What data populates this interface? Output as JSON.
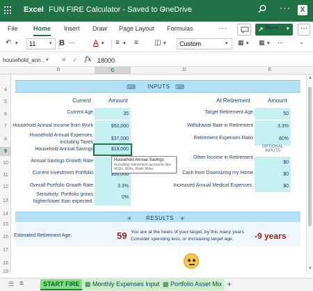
{
  "titlebar": {
    "app_name": "Excel",
    "doc_title": "FUN FIRE Calculator - Saved to OneDrive",
    "app_icon_letter": "X"
  },
  "ribbon": {
    "tabs": [
      "File",
      "Home",
      "Insert",
      "Draw",
      "Page Layout",
      "Formulas"
    ],
    "active_tab": "Home",
    "share_label": "Share",
    "more_label": "···"
  },
  "toolbar": {
    "font_size": "11",
    "bold_label": "B",
    "font_color_label": "A",
    "number_format": "Custom"
  },
  "formula_bar": {
    "name_box": "household_ann...",
    "fx_label": "fx",
    "value": "18000"
  },
  "columns": [
    "B",
    "C",
    "D",
    "E"
  ],
  "selected_column": "C",
  "rows": [
    "4",
    "5",
    "6",
    "7",
    "8",
    "9",
    "10",
    "11",
    "12",
    "13",
    "14",
    "15",
    "16",
    "17",
    "18",
    "19"
  ],
  "selected_row": "9",
  "inputs": {
    "banner": "INPUTS",
    "current_header": "Current",
    "amount_header": "Amount",
    "at_retirement_header": "At Retirement",
    "amount_header_right": "Amount",
    "left_rows": [
      {
        "label": "Current Age",
        "value": "35"
      },
      {
        "label": "Household Annual Income from Work",
        "value": "$50,000"
      },
      {
        "label": "Household Annual Expenses, including Taxes",
        "value": "$37,000"
      },
      {
        "label": "Household Annual Savings",
        "value": "$18,000"
      },
      {
        "label": "Annual Savings Growth Rate",
        "value": ""
      },
      {
        "label": "Current Investment Portfolio",
        "value": "$50,000"
      },
      {
        "label": "Overall Portfolio Growth Rate",
        "value": "3.3%"
      },
      {
        "label": "Sensitivity: Portfolio grows higher/lower than expected.",
        "value": "0%"
      }
    ],
    "right_rows": [
      {
        "label": "Target Retirement Age",
        "value": "50"
      },
      {
        "label": "Withdrawal Rate in Retirement",
        "value": "3.3%"
      },
      {
        "label": "Retirement Expenses Ratio",
        "value": "80%"
      },
      {
        "label": "Other Income in Retirement",
        "value": "$0"
      },
      {
        "label": "Cash from Downsizing my Home",
        "value": "$0"
      },
      {
        "label": "Increased Annual Medical Expenses.",
        "value": "$0"
      }
    ],
    "optional_note": "OPTIONAL INPUTS"
  },
  "tooltip": {
    "title": "Household Annual Savings",
    "body": "Including retirement accounts like 401K, IRAs, Roth IRAs."
  },
  "results": {
    "banner": "RESULTS",
    "label": "Estimated Retirement Age.",
    "age": "59",
    "message": "You are at the heels of your target, by this many years. Consider spending less, or increasing target age.",
    "difference": "-9 years"
  },
  "sheet_tabs": [
    "START FIRE",
    "Monthly Expenses Input",
    "Portfolio Asset Mix"
  ],
  "active_sheet": "START FIRE",
  "colors": {
    "excel_green": "#217346",
    "banner_blue": "#b3e0f5",
    "input_cyan": "#c7f0f2",
    "result_red": "#a0231a"
  }
}
